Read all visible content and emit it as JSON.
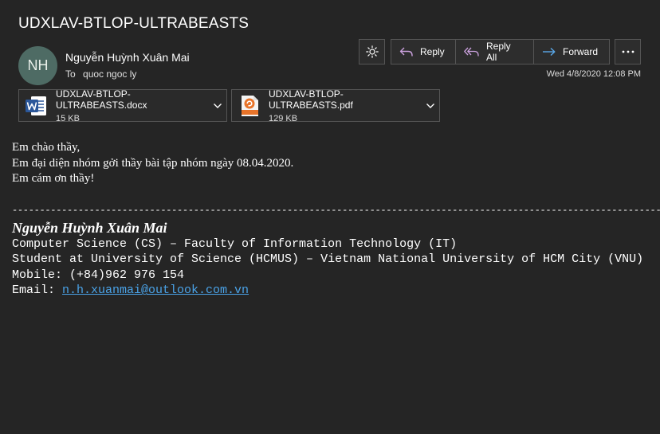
{
  "subject": "UDXLAV-BTLOP-ULTRABEASTS",
  "sender": {
    "initials": "NH",
    "name": "Nguyễn Huỳnh Xuân Mai",
    "to_label": "To",
    "to_name": "quoc ngoc ly",
    "avatar_color": "#4e6b64"
  },
  "toolbar": {
    "theme_icon": "sun-icon",
    "reply_label": "Reply",
    "reply_all_label": "Reply All",
    "forward_label": "Forward",
    "more_icon": "ellipsis-icon"
  },
  "date": "Wed 4/8/2020 12:08 PM",
  "attachments": [
    {
      "name": "UDXLAV-BTLOP-ULTRABEASTS.docx",
      "size": "15 KB",
      "icon": "word-icon"
    },
    {
      "name": "UDXLAV-BTLOP-ULTRABEASTS.pdf",
      "size": "129 KB",
      "icon": "pdf-icon"
    }
  ],
  "body": {
    "lines": [
      "Em chào thầy,",
      "Em đại diện nhóm gởi thầy bài tập nhóm ngày 08.04.2020.",
      "Em cám ơn thầy!"
    ]
  },
  "signature": {
    "divider": "-------------------------------------------------------------------------------------------------------------------------",
    "name": "Nguyễn Huỳnh Xuân Mai",
    "line1": "Computer Science (CS) – Faculty of Information Technology (IT)",
    "line2": "Student at University of Science (HCMUS) – Vietnam National University of HCM City (VNU)",
    "mobile": "Mobile: (+84)962 976 154",
    "email_label": "Email: ",
    "email": "n.h.xuanmai@outlook.com.vn"
  },
  "colors": {
    "background": "#252525",
    "link": "#4aa3e8",
    "word_blue": "#2b579a",
    "pdf_orange": "#e8742a"
  }
}
